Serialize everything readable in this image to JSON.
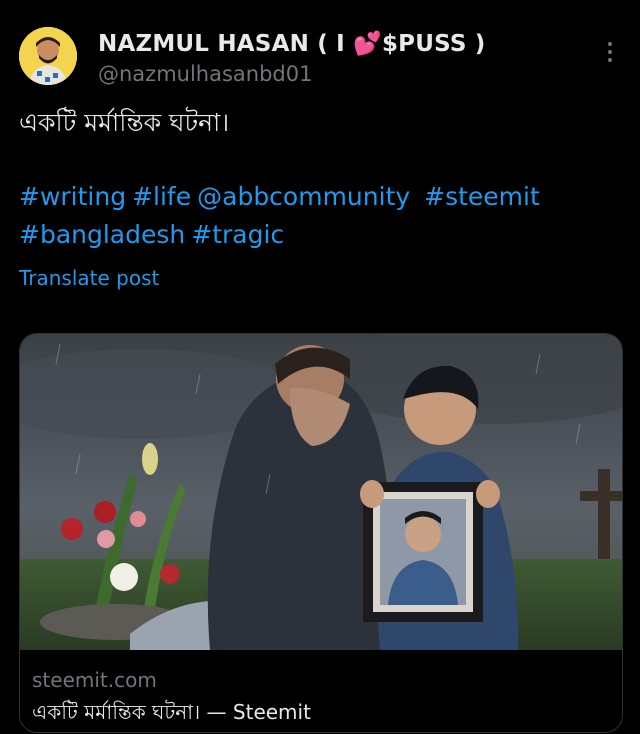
{
  "author": {
    "name_prefix": "NAZMUL HASAN ( I ",
    "name_heart": "💕",
    "name_suffix": "$PUSS )",
    "handle": "@nazmulhasanbd01"
  },
  "post": {
    "text": "একটি মর্মান্তিক ঘটনা।",
    "tags_line1": [
      "#writing",
      "#life",
      "@abbcommunity",
      " #steemit"
    ],
    "tags_line2": [
      "#bangladesh",
      "#tragic"
    ],
    "translate_label": "Translate post"
  },
  "card": {
    "domain": "steemit.com",
    "title": "একটি মর্মান্তিক ঘটনা। — Steemit"
  },
  "icons": {
    "more": "more-vertical-icon"
  }
}
